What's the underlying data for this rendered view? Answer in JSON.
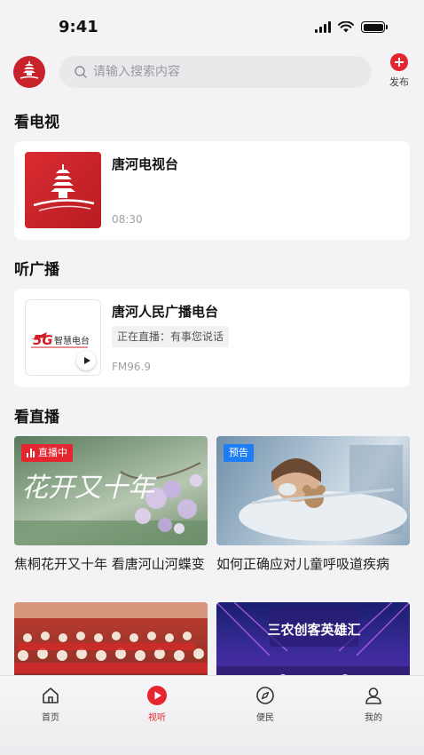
{
  "status_bar": {
    "time": "9:41"
  },
  "header": {
    "logo_alt": "云上唐河",
    "search_placeholder": "请输入搜索内容",
    "publish_label": "发布"
  },
  "tv_section": {
    "title": "看电视",
    "item": {
      "name": "唐河电视台",
      "time": "08:30"
    }
  },
  "radio_section": {
    "title": "听广播",
    "item": {
      "name": "唐河人民广播电台",
      "now_playing": "正在直播：有事您说话",
      "frequency": "FM96.9",
      "logo_text": "智慧电台"
    }
  },
  "live_section": {
    "title": "看直播",
    "items": [
      {
        "badge": "直播中",
        "title": "焦桐花开又十年 看唐河山河蝶变",
        "poster_text": "花开又十年"
      },
      {
        "badge": "预告",
        "title": "如何正确应对儿童呼吸道疾病"
      },
      {
        "badge": "",
        "title": ""
      },
      {
        "badge": "",
        "title": "",
        "poster_text": "三农创客英雄汇"
      }
    ]
  },
  "tabbar": {
    "tabs": [
      {
        "label": "首页",
        "icon": "home-icon",
        "active": false
      },
      {
        "label": "视听",
        "icon": "play-circle-icon",
        "active": true
      },
      {
        "label": "便民",
        "icon": "compass-icon",
        "active": false
      },
      {
        "label": "我的",
        "icon": "user-icon",
        "active": false
      }
    ]
  },
  "colors": {
    "accent": "#e5252f",
    "preview_badge": "#1d7df5",
    "background": "#f3f3f5"
  }
}
